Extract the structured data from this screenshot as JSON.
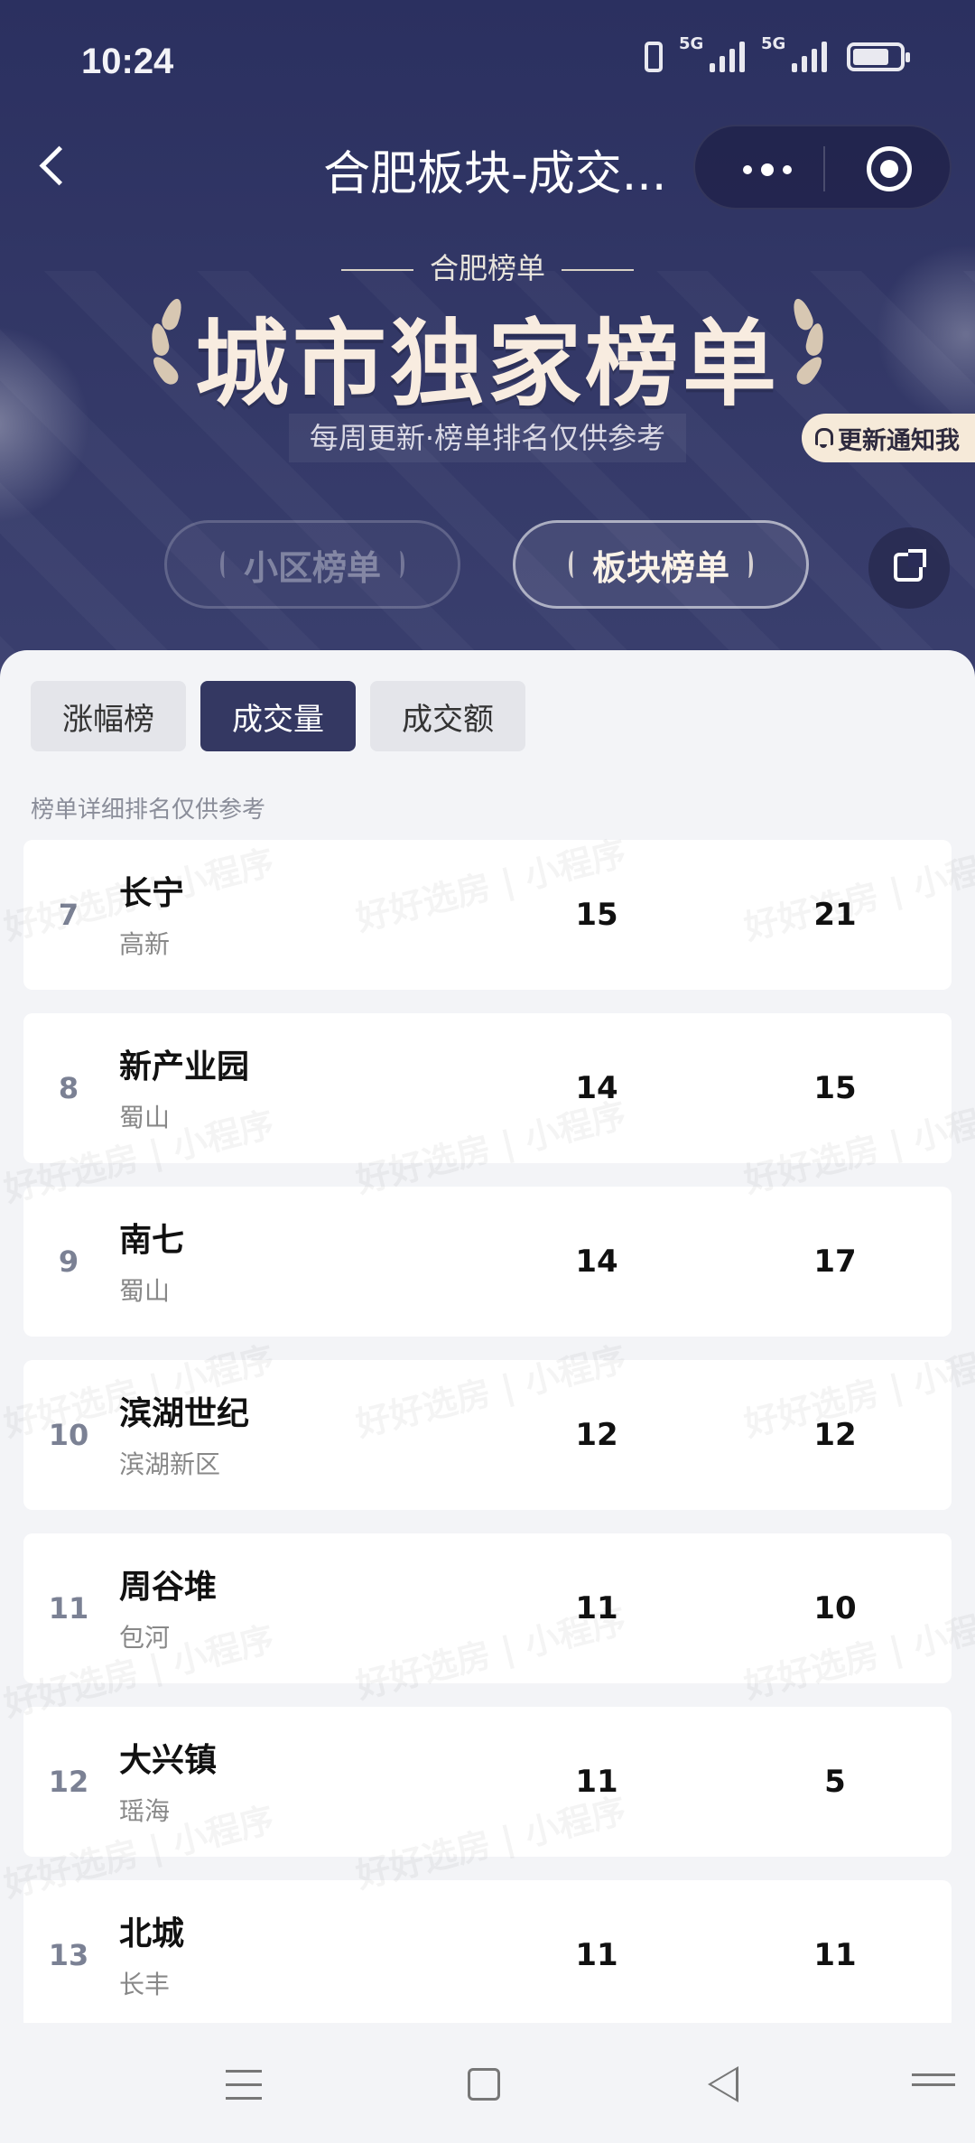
{
  "status_bar": {
    "time": "10:24",
    "signal1_label": "5G",
    "signal2_label": "5G"
  },
  "nav": {
    "title": "合肥板块-成交..."
  },
  "hero": {
    "subtitle": "合肥榜单",
    "title": "城市独家榜单",
    "note": "每周更新·榜单排名仅供参考",
    "notify_label": "更新通知我",
    "segment_community": "小区榜单",
    "segment_block": "板块榜单"
  },
  "tabs": [
    "涨幅榜",
    "成交量",
    "成交额"
  ],
  "active_tab": "成交量",
  "tip": "榜单详细排名仅供参考",
  "rows": [
    {
      "rank": "7",
      "name": "长宁",
      "district": "高新",
      "value1": "15",
      "value2": "21"
    },
    {
      "rank": "8",
      "name": "新产业园",
      "district": "蜀山",
      "value1": "14",
      "value2": "15"
    },
    {
      "rank": "9",
      "name": "南七",
      "district": "蜀山",
      "value1": "14",
      "value2": "17"
    },
    {
      "rank": "10",
      "name": "滨湖世纪",
      "district": "滨湖新区",
      "value1": "12",
      "value2": "12"
    },
    {
      "rank": "11",
      "name": "周谷堆",
      "district": "包河",
      "value1": "11",
      "value2": "10"
    },
    {
      "rank": "12",
      "name": "大兴镇",
      "district": "瑶海",
      "value1": "11",
      "value2": "5"
    },
    {
      "rank": "13",
      "name": "北城",
      "district": "长丰",
      "value1": "11",
      "value2": "11"
    }
  ],
  "watermark": {
    "text": "好好选房 | 小程序"
  },
  "colors": {
    "hero_bg": "#2b3060",
    "active_tab": "#343862",
    "notify_bg": "#f6ead9",
    "title_text": "#f8ece0"
  },
  "icons": [
    "back-icon",
    "more-dots-icon",
    "close-target-icon",
    "bell-icon",
    "share-icon",
    "menu-icon",
    "home-icon",
    "back-triangle-icon"
  ]
}
